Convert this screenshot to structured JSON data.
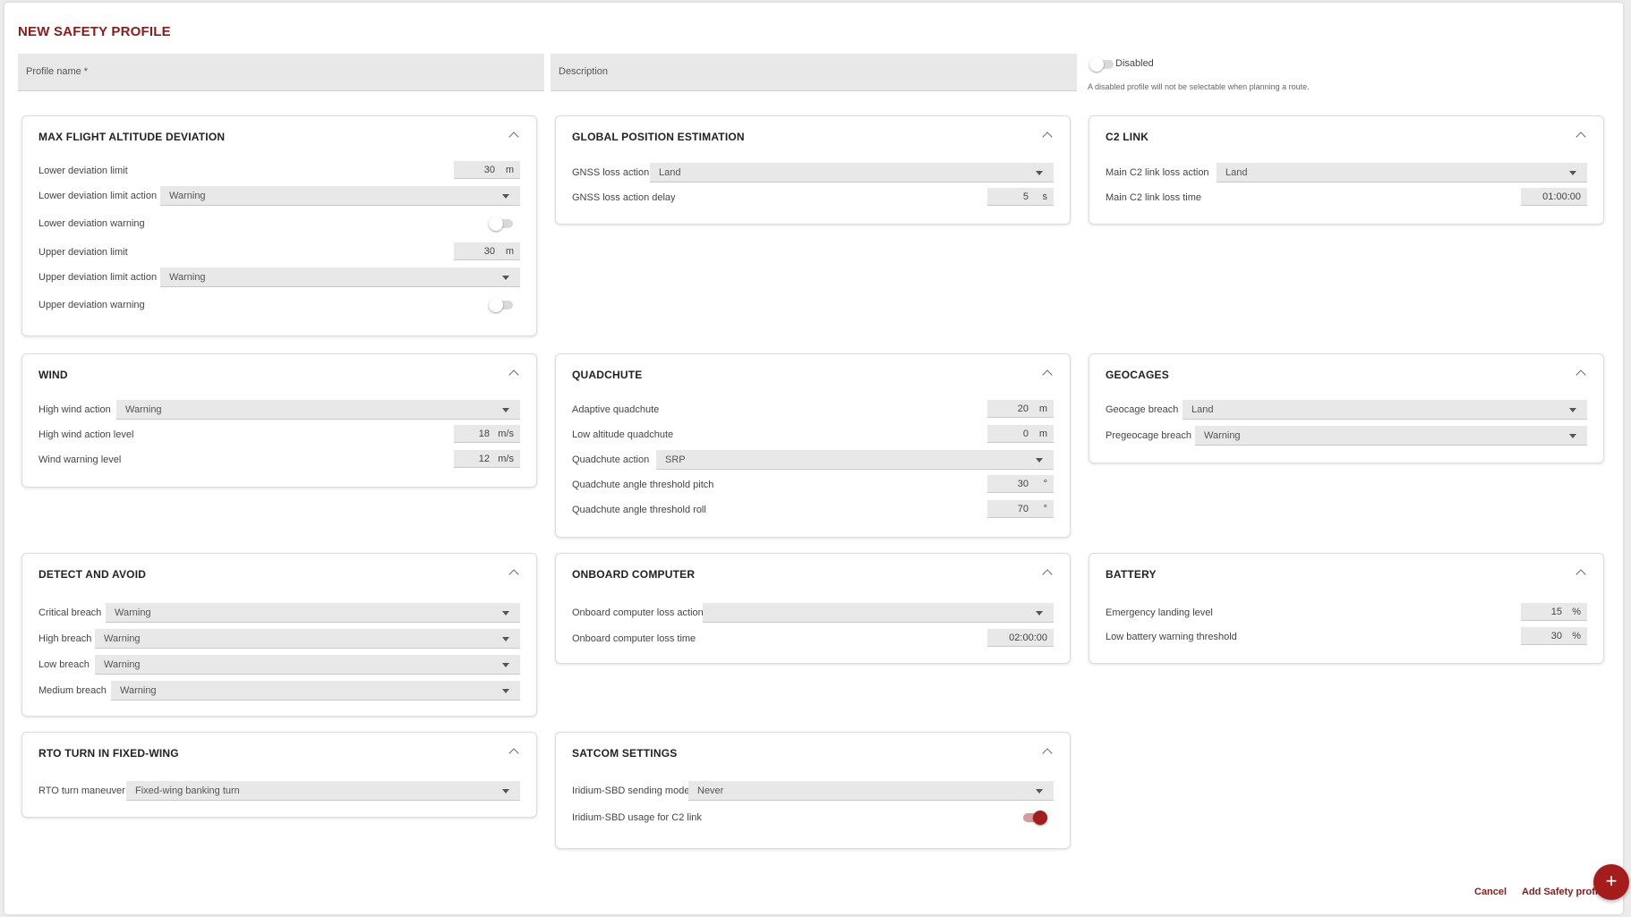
{
  "page": {
    "title": "NEW SAFETY PROFILE",
    "profile_name_placeholder": "Profile name *",
    "description_placeholder": "Description",
    "disabled_label": "Disabled",
    "disabled_hint": "A disabled profile will not be selectable when planning a route."
  },
  "max_altitude": {
    "title": "MAX FLIGHT ALTITUDE DEVIATION",
    "lower_limit_label": "Lower deviation limit",
    "lower_limit_value": "30",
    "lower_limit_unit": "m",
    "lower_action_label": "Lower deviation limit action",
    "lower_action_value": "Warning",
    "lower_warning_label": "Lower deviation warning",
    "upper_limit_label": "Upper deviation limit",
    "upper_limit_value": "30",
    "upper_limit_unit": "m",
    "upper_action_label": "Upper deviation limit action",
    "upper_action_value": "Warning",
    "upper_warning_label": "Upper deviation warning"
  },
  "gnss": {
    "title": "GLOBAL POSITION ESTIMATION",
    "loss_action_label": "GNSS loss action",
    "loss_action_value": "Land",
    "delay_label": "GNSS loss action delay",
    "delay_value": "5",
    "delay_unit": "s"
  },
  "c2": {
    "title": "C2 LINK",
    "loss_action_label": "Main C2 link loss action",
    "loss_action_value": "Land",
    "loss_time_label": "Main C2 link loss time",
    "loss_time_value": "01:00:00"
  },
  "wind": {
    "title": "WIND",
    "action_label": "High wind action",
    "action_value": "Warning",
    "action_level_label": "High wind action level",
    "action_level_value": "18",
    "action_level_unit": "m/s",
    "warning_level_label": "Wind warning level",
    "warning_level_value": "12",
    "warning_level_unit": "m/s"
  },
  "quadchute": {
    "title": "QUADCHUTE",
    "adaptive_label": "Adaptive quadchute",
    "adaptive_value": "20",
    "adaptive_unit": "m",
    "low_alt_label": "Low altitude quadchute",
    "low_alt_value": "0",
    "low_alt_unit": "m",
    "action_label": "Quadchute action",
    "action_value": "SRP",
    "pitch_label": "Quadchute angle threshold pitch",
    "pitch_value": "30",
    "pitch_unit": "°",
    "roll_label": "Quadchute angle threshold roll",
    "roll_value": "70",
    "roll_unit": "°"
  },
  "geocages": {
    "title": "GEOCAGES",
    "breach_label": "Geocage breach",
    "breach_value": "Land",
    "pre_label": "Pregeocage breach",
    "pre_value": "Warning"
  },
  "daa": {
    "title": "DETECT AND AVOID",
    "critical_label": "Critical breach",
    "critical_value": "Warning",
    "high_label": "High breach",
    "high_value": "Warning",
    "low_label": "Low breach",
    "low_value": "Warning",
    "medium_label": "Medium breach",
    "medium_value": "Warning"
  },
  "onboard": {
    "title": "ONBOARD COMPUTER",
    "loss_action_label": "Onboard computer loss action",
    "loss_action_value": "",
    "loss_time_label": "Onboard computer loss time",
    "loss_time_value": "02:00:00"
  },
  "battery": {
    "title": "BATTERY",
    "emergency_label": "Emergency landing level",
    "emergency_value": "15",
    "emergency_unit": "%",
    "low_label": "Low battery warning threshold",
    "low_value": "30",
    "low_unit": "%"
  },
  "rto": {
    "title": "RTO TURN IN FIXED-WING",
    "maneuver_label": "RTO turn maneuver",
    "maneuver_value": "Fixed-wing banking turn"
  },
  "satcom": {
    "title": "SATCOM SETTINGS",
    "mode_label": "Iridium-SBD sending mode",
    "mode_value": "Never",
    "usage_label": "Iridium-SBD usage for C2 link"
  },
  "footer": {
    "cancel_label": "Cancel",
    "add_label": "Add Safety profi",
    "fab_label": "+"
  },
  "colors": {
    "accent": "#8b1a1a",
    "toggle_on": "#a41c1c"
  }
}
